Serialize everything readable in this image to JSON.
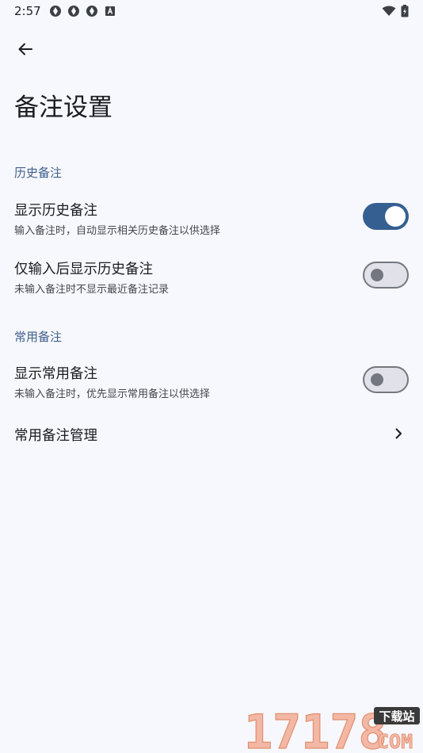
{
  "status_bar": {
    "time": "2:57",
    "notification_icons": [
      "aperture-icon",
      "aperture-icon",
      "aperture-icon",
      "font-a-icon"
    ],
    "right_icons": [
      "wifi-icon",
      "battery-icon"
    ]
  },
  "header": {
    "back_icon": "arrow-left-icon",
    "title": "备注设置"
  },
  "sections": [
    {
      "header": "历史备注",
      "items": [
        {
          "title": "显示历史备注",
          "summary": "输入备注时，自动显示相关历史备注以供选择",
          "switch_on": true
        },
        {
          "title": "仅输入后显示历史备注",
          "summary": "未输入备注时不显示最近备注记录",
          "switch_on": false
        }
      ]
    },
    {
      "header": "常用备注",
      "items": [
        {
          "title": "显示常用备注",
          "summary": "未输入备注时，优先显示常用备注以供选择",
          "switch_on": false
        },
        {
          "title": "常用备注管理",
          "chevron_icon": "chevron-right-icon"
        }
      ]
    }
  ],
  "watermark": {
    "number": "17178",
    "tag": "下载站",
    "domain": "COM"
  },
  "colors": {
    "background": "#f7f8fd",
    "accent": "#355f91",
    "section_header": "#3d5f8c",
    "switch_off_track": "#e1e2e9",
    "switch_off_outline": "#74777f"
  }
}
